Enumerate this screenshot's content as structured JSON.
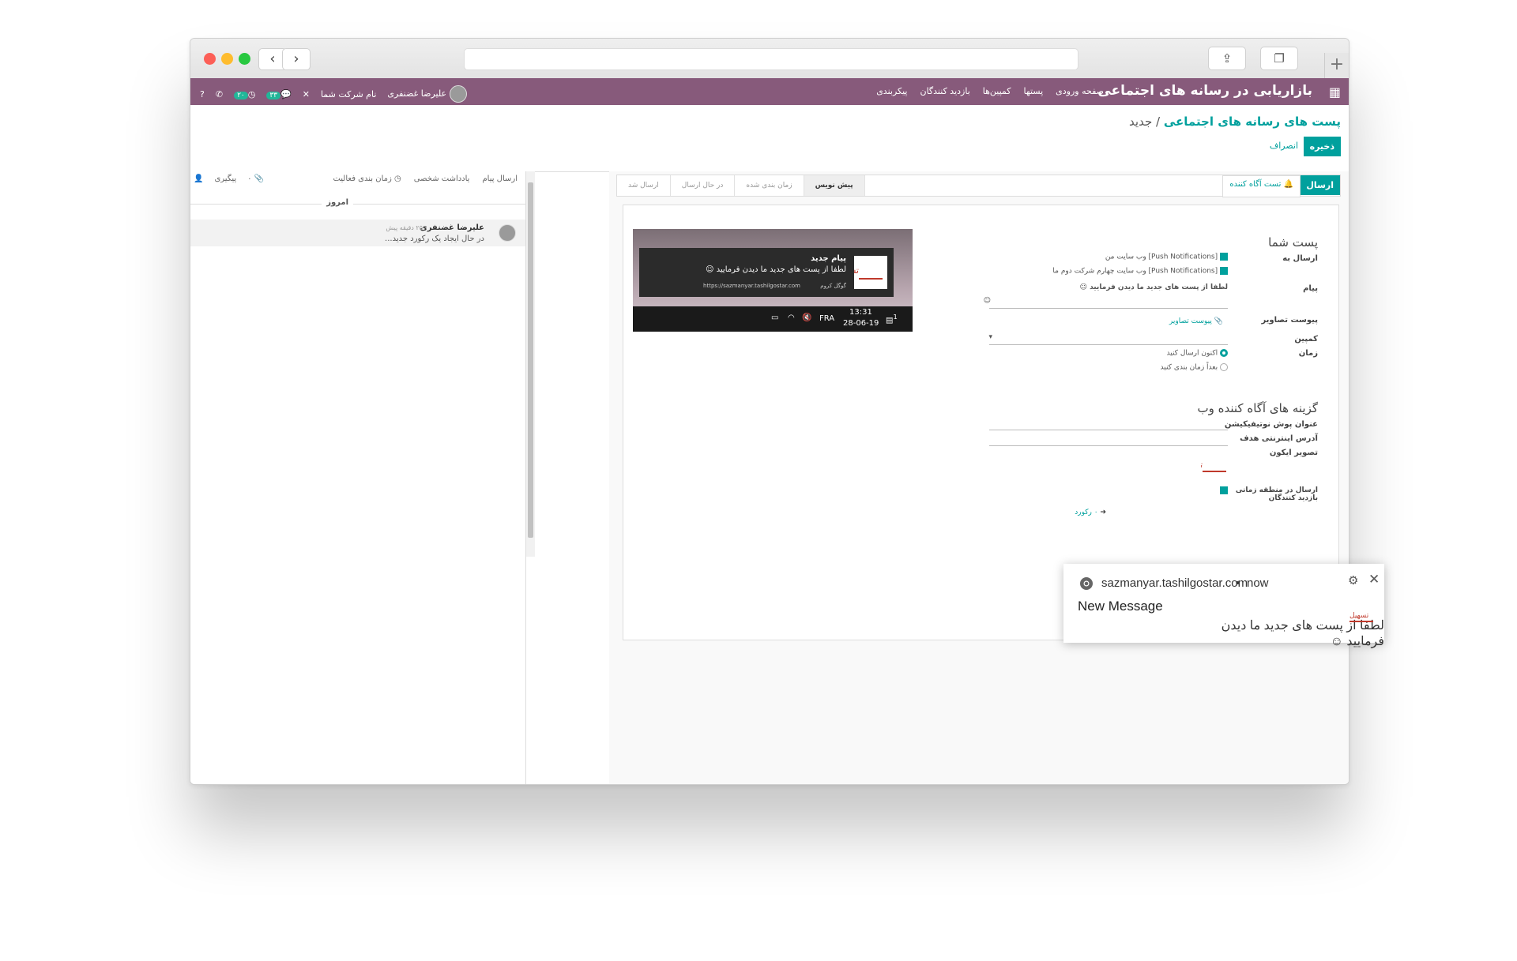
{
  "app": {
    "brand": "بازاریابی در رسانه های اجتماعی",
    "menu": [
      "صفحه ورودی",
      "پستها",
      "کمپین‌ها",
      "بازدید کنندگان",
      "پیکربندی"
    ],
    "company": "نام شرکت شما",
    "user": "علیرضا غضنفری",
    "badge_messages": "۳۳",
    "badge_activities": "۲۰",
    "apps_icon": "grid-icon"
  },
  "controls": {
    "breadcrumb_parent": "پست های رسانه های اجتماعی",
    "breadcrumb_sep": " / ",
    "breadcrumb_current": "جدید",
    "save": "ذخیره",
    "discard": "انصراف"
  },
  "status": {
    "send": "ارسال",
    "test": "تست آگاه کننده",
    "stages": [
      "ارسال شد",
      "در حال ارسال",
      "زمان بندی شده",
      "پیش نویس"
    ],
    "active_stage": "پیش نویس"
  },
  "form": {
    "section_title": "پست شما",
    "send_to_label": "ارسال به",
    "accounts": [
      "[Push Notifications] وب سایت من",
      "[Push Notifications] وب سایت چهارم شرکت دوم ما"
    ],
    "message_label": "پیام",
    "message_value": "لطفا از پست های جدید  ما دیدن فرمایید ☺",
    "attach_label": "پیوست تصاویر",
    "attach_link": "پیوست تصاویر",
    "campaign_label": "کمپین",
    "time_label": "زمان",
    "time_now": "اکنون ارسال کنید",
    "time_later": "بعداً زمان بندی کنید",
    "web_options_title": "گزینه های آگاه کننده وب",
    "push_title_label": "عنوان پوش نوتیفیکیشن",
    "target_url_label": "آدرس اینترنتی هدف",
    "icon_label": "تصویر ایکون",
    "timezone_label_1": "ارسال در منطقه زمانی",
    "timezone_label_2": "بازدید کنندگان",
    "pager": "۰ رکورد"
  },
  "preview": {
    "title": "پیام جدید",
    "body": "لطفا از پست های جدید ما دیدن فرمایید ☺",
    "browser": "گوگل کروم",
    "url": "https://sazmanyar.tashilgostar.com",
    "time": "13:31",
    "date": "28-06-19",
    "lang": "FRA",
    "notif_count": "1"
  },
  "chatter": {
    "send_message": "ارسال پیام",
    "log_note": "یادداشت شخصی",
    "schedule": "زمان بندی فعالیت",
    "attachments": "۰",
    "follow": "پیگیری",
    "today": "امروز",
    "author": "علیرضا غضنفری",
    "time_ago": "۲۵ دقیقه پیش",
    "message": "در حال ایجاد یک رکورد جدید..."
  },
  "toast": {
    "domain": "sazmanyar.tashilgostar.com",
    "sep": "•",
    "when": "now",
    "title": "New Message",
    "body": "لطفا از پست های جدید  ما دیدن فرمایید ☺"
  }
}
